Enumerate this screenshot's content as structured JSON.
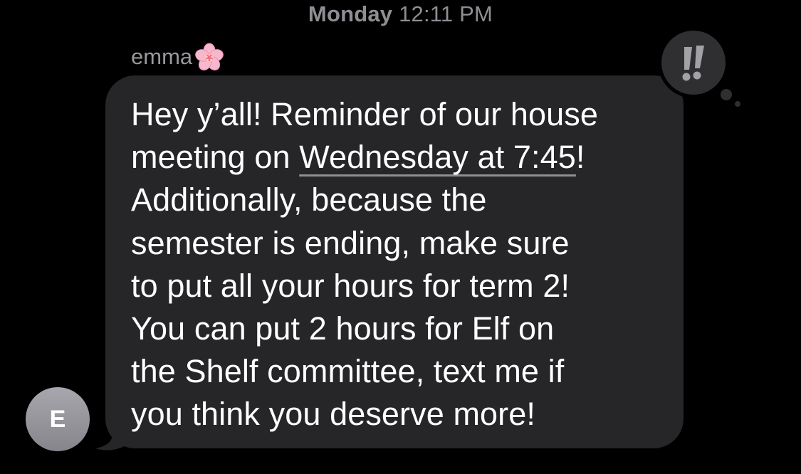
{
  "conversation": {
    "timestamp": {
      "day": "Monday",
      "time": "12:11 PM"
    },
    "sender_name": "emma",
    "sender_emoji": "cherry-blossom-emoji",
    "avatar_initial": "E",
    "tapback_reaction": "!!",
    "tapback_icon": "double-exclamation-icon",
    "message": {
      "line1": "Hey y’all! Reminder of our house",
      "line2_before": "meeting on ",
      "line2_link": "Wednesday at 7:45",
      "line2_after": "!",
      "line3": "Additionally, because the",
      "line4": "semester is ending, make sure",
      "line5": "to put all your hours for term 2!",
      "line6": "You can put 2 hours for Elf on",
      "line7": "the Shelf committee, text me if",
      "line8": "you think you deserve more!"
    }
  },
  "colors": {
    "background": "#000000",
    "bubble": "#262628",
    "timestamp_text": "#8e8e93",
    "message_text": "#ffffff",
    "avatar": "#98989e"
  }
}
